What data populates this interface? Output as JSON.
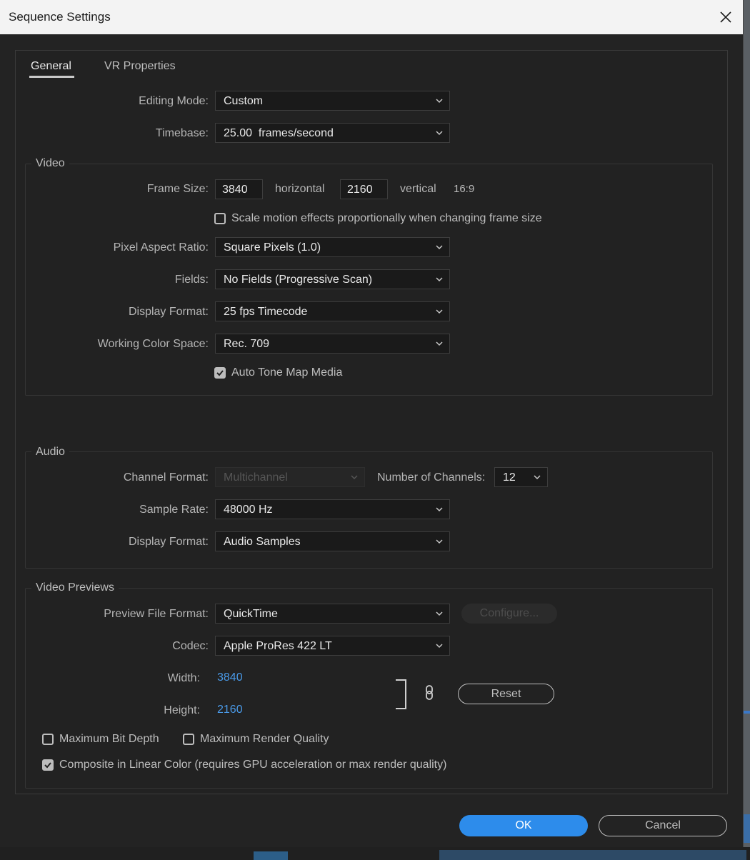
{
  "window": {
    "title": "Sequence Settings",
    "close_icon": "close-icon"
  },
  "tabs": [
    {
      "label": "General",
      "active": true
    },
    {
      "label": "VR Properties",
      "active": false
    }
  ],
  "general": {
    "editing_mode": {
      "label": "Editing Mode:",
      "value": "Custom"
    },
    "timebase": {
      "label": "Timebase:",
      "value": "25.00  frames/second"
    }
  },
  "video": {
    "title": "Video",
    "frame_size": {
      "label": "Frame Size:",
      "horizontal": "3840",
      "horizontal_label": "horizontal",
      "vertical": "2160",
      "vertical_label": "vertical",
      "aspect": "16:9"
    },
    "scale_motion": {
      "label": "Scale motion effects proportionally when changing frame size",
      "checked": false
    },
    "pixel_aspect": {
      "label": "Pixel Aspect Ratio:",
      "value": "Square Pixels (1.0)"
    },
    "fields": {
      "label": "Fields:",
      "value": "No Fields (Progressive Scan)"
    },
    "display_format": {
      "label": "Display Format:",
      "value": "25 fps Timecode"
    },
    "color_space": {
      "label": "Working Color Space:",
      "value": "Rec. 709"
    },
    "auto_tone_map": {
      "label": "Auto Tone Map Media",
      "checked": true
    }
  },
  "audio": {
    "title": "Audio",
    "channel_format": {
      "label": "Channel Format:",
      "value": "Multichannel",
      "disabled": true
    },
    "num_channels": {
      "label": "Number of Channels:",
      "value": "12"
    },
    "sample_rate": {
      "label": "Sample Rate:",
      "value": "48000 Hz"
    },
    "display_format": {
      "label": "Display Format:",
      "value": "Audio Samples"
    }
  },
  "previews": {
    "title": "Video Previews",
    "file_format": {
      "label": "Preview File Format:",
      "value": "QuickTime"
    },
    "configure_label": "Configure...",
    "codec": {
      "label": "Codec:",
      "value": "Apple ProRes 422 LT"
    },
    "width": {
      "label": "Width:",
      "value": "3840"
    },
    "height": {
      "label": "Height:",
      "value": "2160"
    },
    "reset_label": "Reset",
    "max_bit_depth": {
      "label": "Maximum Bit Depth",
      "checked": false
    },
    "max_render_quality": {
      "label": "Maximum Render Quality",
      "checked": false
    },
    "composite_linear": {
      "label": "Composite in Linear Color (requires GPU acceleration or max render quality)",
      "checked": true
    }
  },
  "footer": {
    "ok_label": "OK",
    "cancel_label": "Cancel"
  },
  "colors": {
    "accent": "#2d8ceb",
    "link_value": "#4a9ae8",
    "background": "#232323"
  }
}
